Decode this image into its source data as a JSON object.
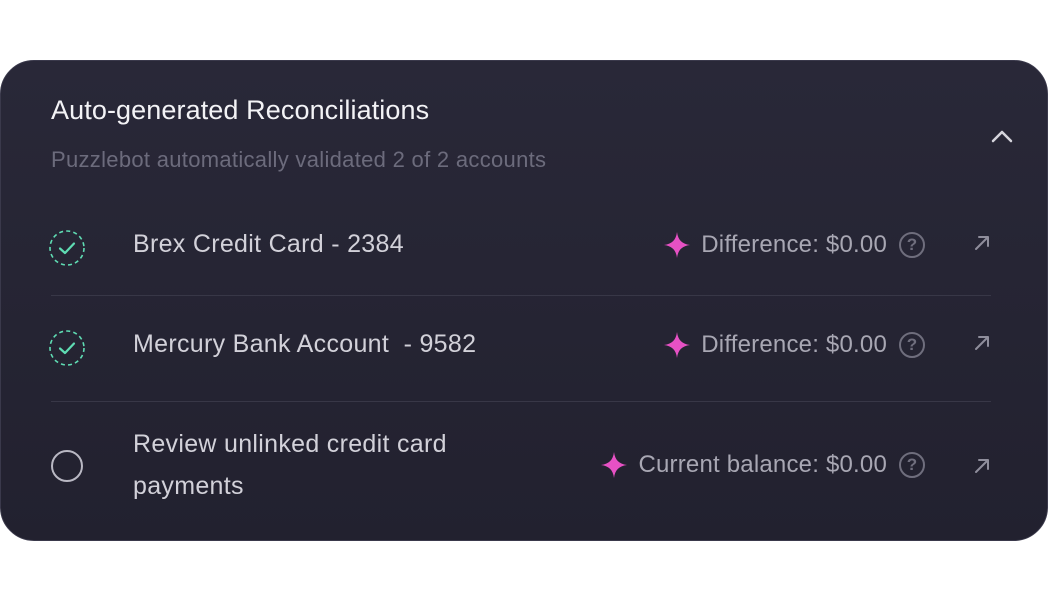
{
  "header": {
    "title": "Auto-generated Reconciliations",
    "subtitle": "Puzzlebot automatically validated 2 of 2 accounts",
    "collapse_icon": "chevron-up-icon"
  },
  "colors": {
    "card_background": "#262535",
    "check_accent": "#5fdcb3",
    "sparkle_accent": "#e651c4"
  },
  "rows": [
    {
      "label": "Brex Credit Card - 2384",
      "status": "complete",
      "metric": "Difference: $0.00"
    },
    {
      "label": "Mercury Bank Account  - 9582",
      "status": "complete",
      "metric": "Difference: $0.00"
    },
    {
      "label": "Review unlinked credit card payments",
      "status": "incomplete",
      "metric": "Current balance: $0.00"
    }
  ],
  "icons": {
    "complete": "dashed-check-circle-icon",
    "incomplete": "empty-circle-icon",
    "metric": "sparkle-icon",
    "help": "question-circle-icon",
    "open": "arrow-up-right-icon"
  }
}
